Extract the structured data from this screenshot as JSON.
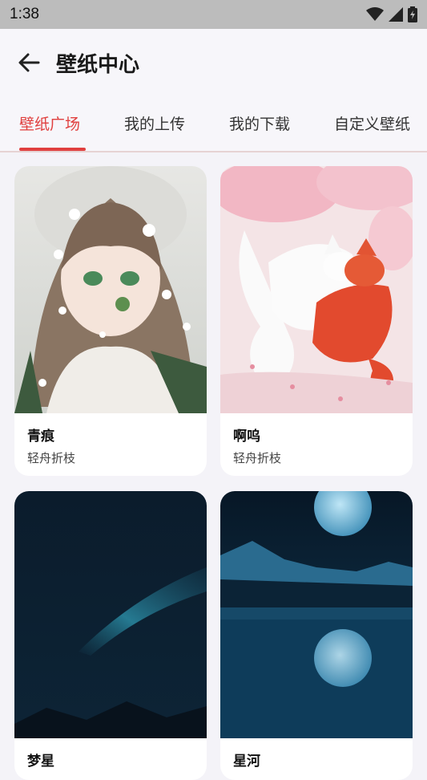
{
  "status": {
    "time": "1:38"
  },
  "header": {
    "title": "壁纸中心"
  },
  "tabs": [
    {
      "label": "壁纸广场",
      "active": true
    },
    {
      "label": "我的上传",
      "active": false
    },
    {
      "label": "我的下载",
      "active": false
    },
    {
      "label": "自定义壁纸",
      "active": false
    }
  ],
  "wallpapers": [
    {
      "title": "青痕",
      "author": "轻舟折枝"
    },
    {
      "title": "啊呜",
      "author": "轻舟折枝"
    },
    {
      "title": "梦星",
      "author": ""
    },
    {
      "title": "星河",
      "author": ""
    }
  ],
  "colors": {
    "accent": "#e0403f"
  }
}
